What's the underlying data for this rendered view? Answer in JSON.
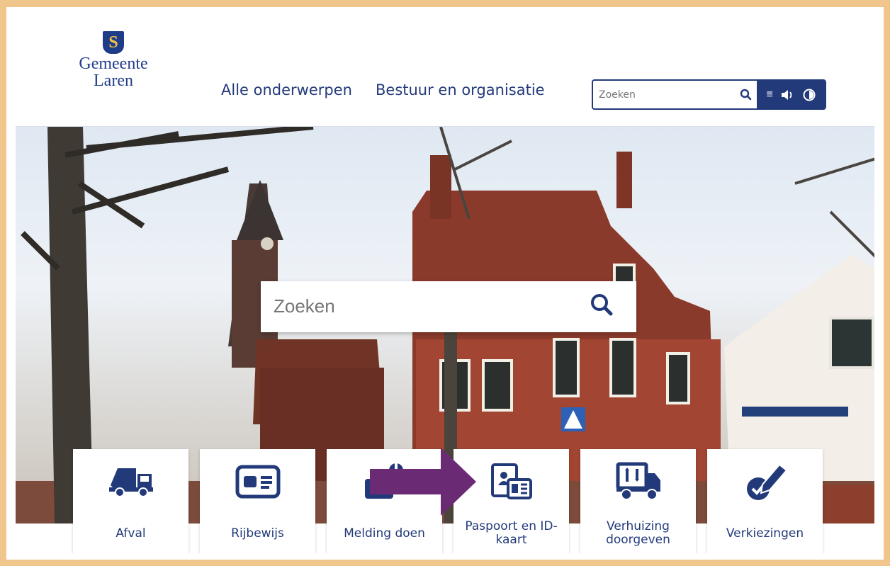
{
  "logo": {
    "line1": "Gemeente",
    "line2": "Laren",
    "shield_letter": "S"
  },
  "nav": [
    {
      "label": "Alle onderwerpen"
    },
    {
      "label": "Bestuur en organisatie"
    }
  ],
  "header_search": {
    "placeholder": "Zoeken"
  },
  "hero_search": {
    "placeholder": "Zoeken"
  },
  "tiles": [
    {
      "label": "Afval",
      "icon": "garbage-truck-icon"
    },
    {
      "label": "Rijbewijs",
      "icon": "drivers-license-icon"
    },
    {
      "label": "Melding doen",
      "icon": "report-icon"
    },
    {
      "label": "Paspoort en ID-kaart",
      "icon": "passport-id-icon"
    },
    {
      "label": "Verhuizing doorgeven",
      "icon": "moving-truck-icon"
    },
    {
      "label": "Verkiezingen",
      "icon": "ballot-pen-icon"
    }
  ],
  "colors": {
    "brand": "#233a7a",
    "frame": "#f0c68c",
    "arrow": "#6b2a74"
  }
}
